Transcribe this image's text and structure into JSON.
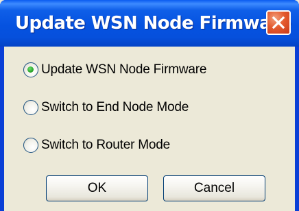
{
  "dialog": {
    "title": "Update WSN Node Firmware",
    "close_icon": "close-x-icon",
    "options": [
      {
        "label": "Update WSN Node Firmware",
        "selected": true
      },
      {
        "label": "Switch to End Node Mode",
        "selected": false
      },
      {
        "label": "Switch to Router Mode",
        "selected": false
      }
    ],
    "ok_label": "OK",
    "cancel_label": "Cancel"
  },
  "colors": {
    "titlebar": "#0552e0",
    "close_button": "#e45b2f",
    "client_background": "#ece9d8",
    "radio_check": "#2aa62a"
  }
}
